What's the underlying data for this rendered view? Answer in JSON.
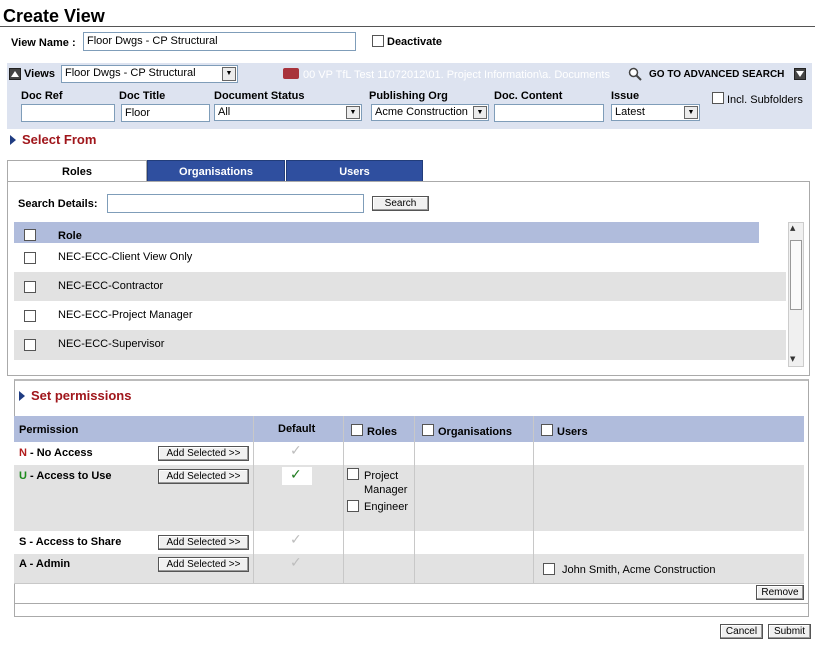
{
  "page": {
    "title": "Create View"
  },
  "view_name": {
    "label": "View Name :",
    "value": "Floor Dwgs - CP Structural",
    "deactivate_label": "Deactivate"
  },
  "views_bar": {
    "label": "Views",
    "selected_view": "Floor Dwgs - CP Structural",
    "path": "00 VP TfL Test 11072012\\01. Project Information\\a. Documents",
    "advanced_search": "GO TO ADVANCED SEARCH"
  },
  "filters": {
    "doc_ref": {
      "label": "Doc Ref",
      "value": ""
    },
    "doc_title": {
      "label": "Doc Title",
      "value": "Floor"
    },
    "document_status": {
      "label": "Document Status",
      "value": "All"
    },
    "publishing_org": {
      "label": "Publishing Org",
      "value": "Acme Construction"
    },
    "doc_content": {
      "label": "Doc. Content",
      "value": ""
    },
    "issue": {
      "label": "Issue",
      "value": "Latest"
    },
    "incl_subfolders": "Incl. Subfolders"
  },
  "select_from": {
    "heading": "Select From",
    "tabs": [
      "Roles",
      "Organisations",
      "Users"
    ],
    "search_label": "Search Details:",
    "search_value": "",
    "search_button": "Search",
    "column_header": "Role",
    "roles": [
      "NEC-ECC-Client View Only",
      "NEC-ECC-Contractor",
      "NEC-ECC-Project Manager",
      "NEC-ECC-Supervisor"
    ]
  },
  "permissions": {
    "heading": "Set permissions",
    "columns": {
      "permission": "Permission",
      "default": "Default",
      "roles": "Roles",
      "organisations": "Organisations",
      "users": "Users"
    },
    "add_selected": "Add Selected >>",
    "rows": [
      {
        "code": "N",
        "label": " - No Access",
        "code_color": "#b11b1b",
        "default_on": false
      },
      {
        "code": "U",
        "label": " - Access to Use",
        "code_color": "#1d8a1d",
        "default_on": true,
        "roles": [
          "Project Manager",
          "Engineer"
        ]
      },
      {
        "code": "S",
        "label": " - Access to Share",
        "code_color": "#000000",
        "default_on": false
      },
      {
        "code": "A",
        "label": " - Admin",
        "code_color": "#000000",
        "default_on": false,
        "users": [
          "John Smith, Acme Construction"
        ]
      }
    ],
    "remove_button": "Remove"
  },
  "footer": {
    "cancel": "Cancel",
    "submit": "Submit"
  },
  "colors": {
    "tab_active": "#ffffff",
    "tab_inactive": "#2f4f9f",
    "header_bar": "#b0bcdc",
    "heading_red": "#a0161b"
  }
}
